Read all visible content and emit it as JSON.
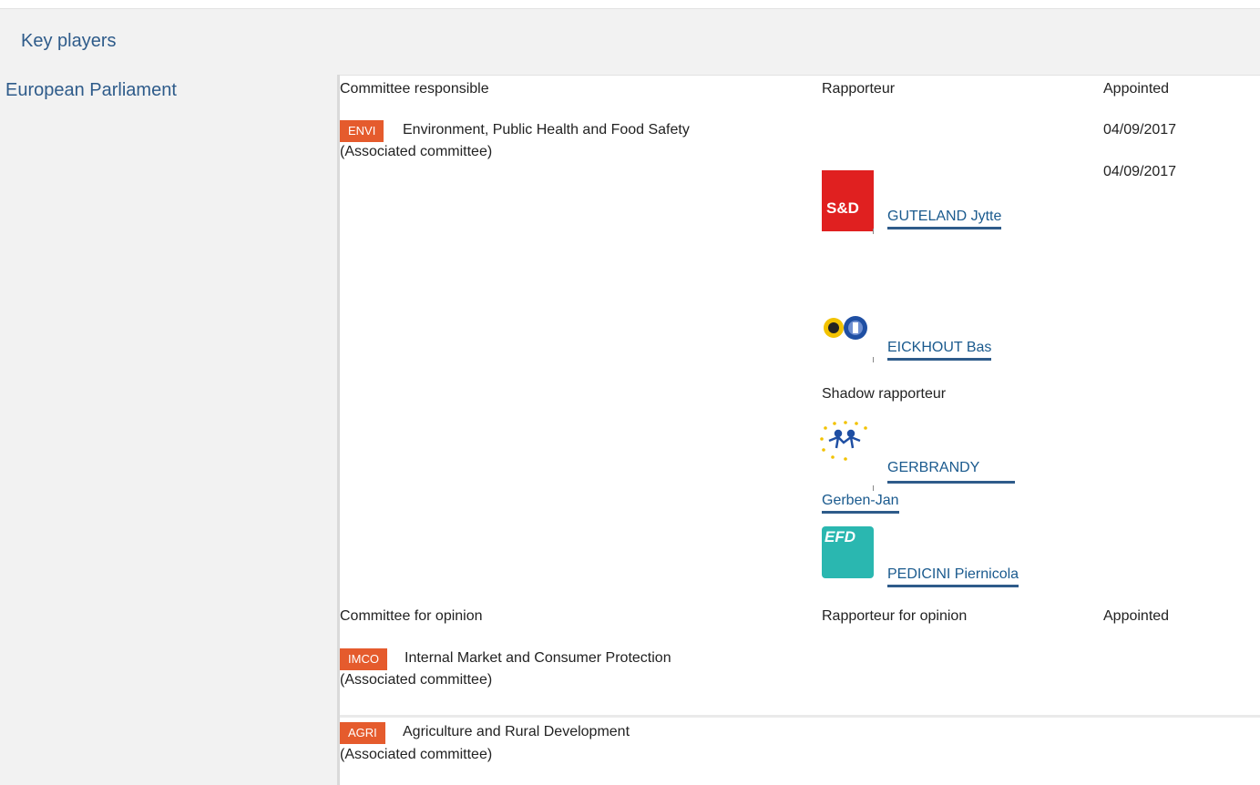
{
  "header": {
    "title": "Key players"
  },
  "institution": {
    "label": "European Parliament"
  },
  "responsible": {
    "col_committee": "Committee responsible",
    "col_rapporteur": "Rapporteur",
    "col_appointed": "Appointed",
    "committee_code": "ENVI",
    "committee_name": "Environment, Public Health and Food Safety",
    "committee_note": "(Associated committee)",
    "appointed_dates": [
      "04/09/2017",
      "04/09/2017"
    ],
    "rapporteurs": [
      {
        "name": "GUTELAND Jytte",
        "group_logo": "s-and-d-logo",
        "logo_text": "S&D"
      },
      {
        "name": "EICKHOUT Bas",
        "group_logo": "greens-efa-logo"
      }
    ],
    "shadow_label": "Shadow rapporteur",
    "shadows": [
      {
        "name_line1": "GERBRANDY",
        "name_line2": "Gerben-Jan",
        "group_logo": "alde-logo"
      },
      {
        "name": "PEDICINI Piernicola",
        "group_logo": "efdd-logo",
        "logo_text": "EFD"
      }
    ]
  },
  "opinion": {
    "col_committee": "Committee for opinion",
    "col_rapporteur": "Rapporteur for opinion",
    "col_appointed": "Appointed",
    "committees": [
      {
        "code": "IMCO",
        "name": "Internal Market and Consumer Protection",
        "note": "(Associated committee)"
      },
      {
        "code": "AGRI",
        "name": "Agriculture and Rural Development",
        "note": "(Associated committee)"
      }
    ]
  },
  "colors": {
    "badge": "#e55b2d",
    "link": "#1a5a8e",
    "header_text": "#2e5b8a",
    "panel_bg": "#f2f2f2"
  }
}
